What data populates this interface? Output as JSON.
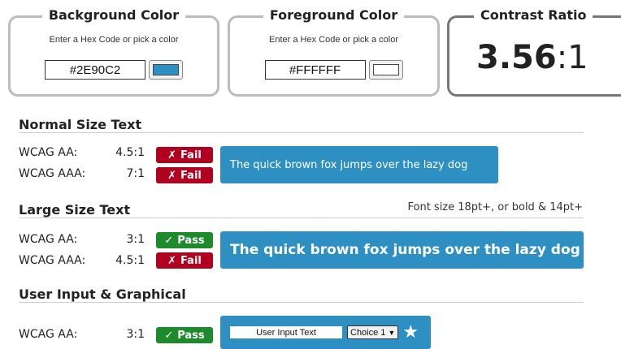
{
  "background_color": {
    "title": "Background Color",
    "hint": "Enter a Hex Code or pick a color",
    "hex_value": "#2E90C2",
    "swatch_color": "#2E90C2"
  },
  "foreground_color": {
    "title": "Foreground Color",
    "hint": "Enter a Hex Code or pick a color",
    "hex_value": "#FFFFFF",
    "swatch_color": "#FFFFFF"
  },
  "contrast_ratio": {
    "title": "Contrast Ratio",
    "value_main": "3.56",
    "value_suffix": ":1"
  },
  "normal_text": {
    "title": "Normal Size Text",
    "rows": [
      {
        "label": "WCAG AA:",
        "ratio": "4.5:1",
        "result_icon": "✗",
        "result": "Fail"
      },
      {
        "label": "WCAG AAA:",
        "ratio": "7:1",
        "result_icon": "✗",
        "result": "Fail"
      }
    ],
    "sample": "The quick brown fox jumps over the lazy dog"
  },
  "large_text": {
    "title": "Large Size Text",
    "note": "Font size 18pt+, or bold & 14pt+",
    "rows": [
      {
        "label": "WCAG AA:",
        "ratio": "3:1",
        "result_icon": "✓",
        "result": "Pass"
      },
      {
        "label": "WCAG AAA:",
        "ratio": "4.5:1",
        "result_icon": "✗",
        "result": "Fail"
      }
    ],
    "sample": "The quick brown fox jumps over the lazy dog"
  },
  "graphical": {
    "title": "User Input & Graphical",
    "rows": [
      {
        "label": "WCAG AA:",
        "ratio": "3:1",
        "result_icon": "✓",
        "result": "Pass"
      }
    ],
    "input_value": "User Input Text",
    "select_value": "Choice 1",
    "icon": "star-icon"
  },
  "colors": {
    "fail": "#b10020",
    "pass": "#1d8a2c",
    "accent": "#2E90C2"
  }
}
